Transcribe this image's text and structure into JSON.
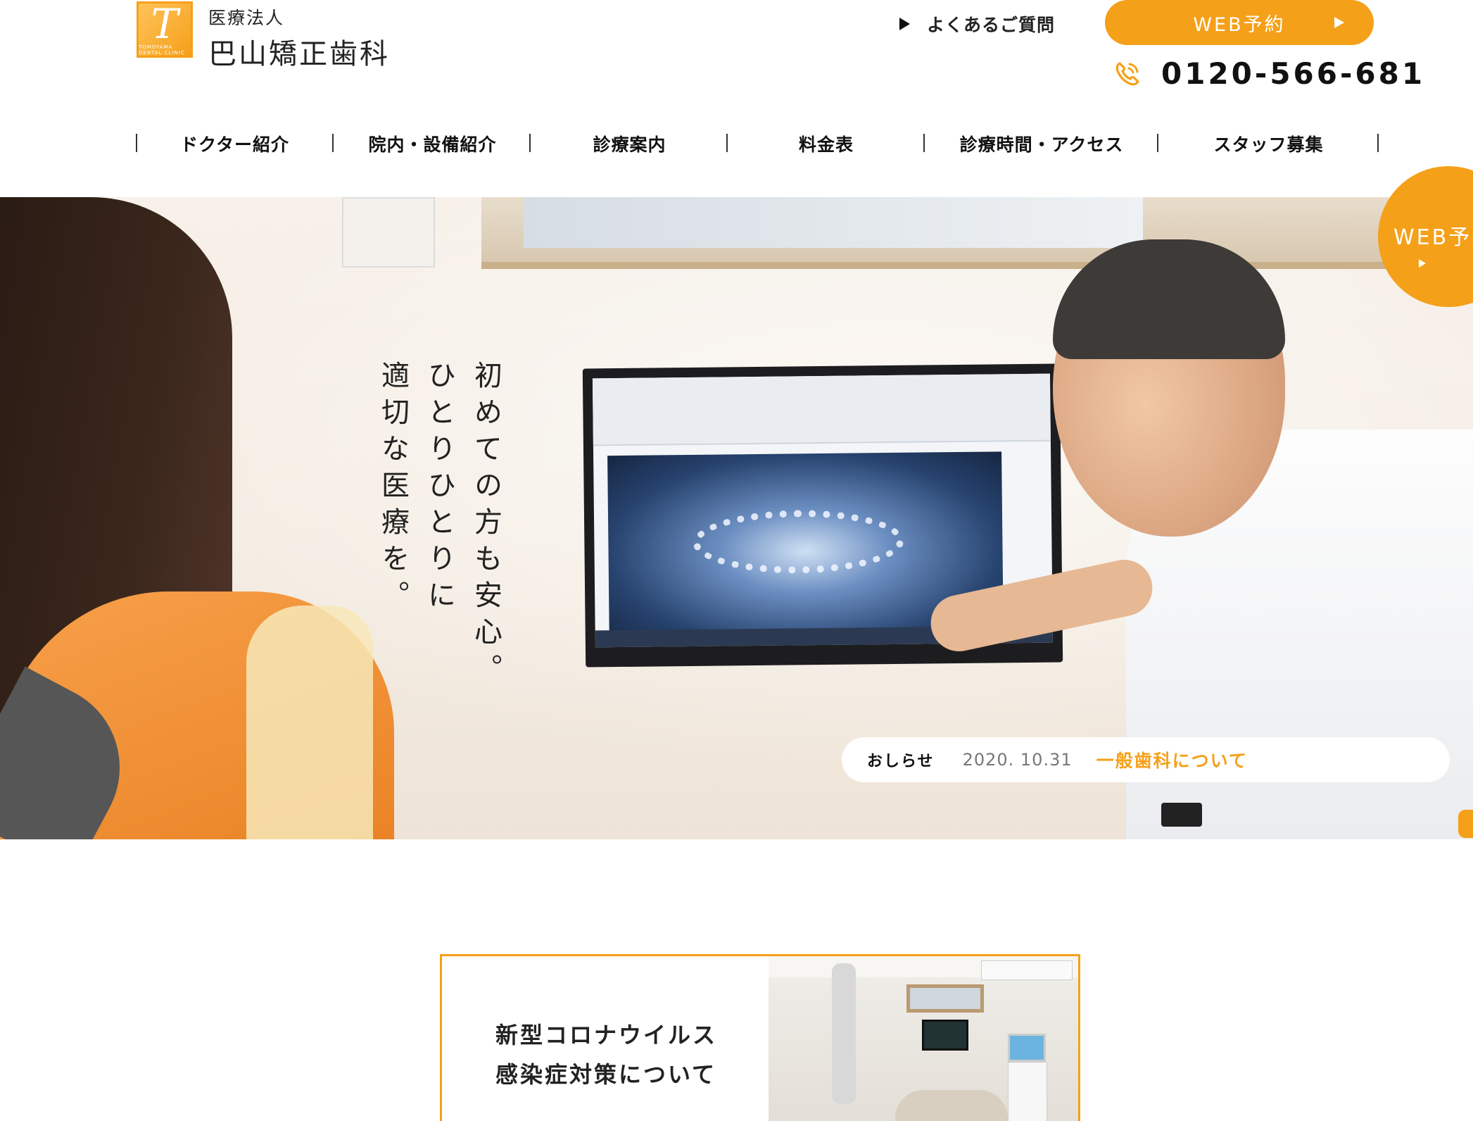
{
  "header": {
    "logo": {
      "mark_letter": "T",
      "mark_text": "TOMOYAMA DENTAL CLINIC",
      "sub": "医療法人",
      "main": "巴山矯正歯科"
    },
    "faq_label": "よくあるご質問",
    "web_reserve_label": "WEB予約",
    "phone": "0120-566-681"
  },
  "nav": {
    "items": [
      {
        "label": "ドクター紹介"
      },
      {
        "label": "院内・設備紹介"
      },
      {
        "label": "診療案内"
      },
      {
        "label": "料金表"
      },
      {
        "label": "診療時間・アクセス"
      },
      {
        "label": "スタッフ募集"
      }
    ]
  },
  "hero": {
    "catch": [
      "初めての方も安心。",
      "ひとりひとりに",
      "適切な医療を。"
    ],
    "side_web_label": "WEB予約"
  },
  "news": {
    "label": "おしらせ",
    "date": "2020. 10.31",
    "title": "一般歯科について"
  },
  "card": {
    "line1": "新型コロナウイルス",
    "line2": "感染症対策について"
  },
  "colors": {
    "accent": "#f5a019",
    "text": "#222222",
    "background": "#ffffff"
  },
  "icons": {
    "phone": "phone-icon",
    "faq": "triangle-right-icon",
    "web_arrow": "triangle-right-icon"
  }
}
